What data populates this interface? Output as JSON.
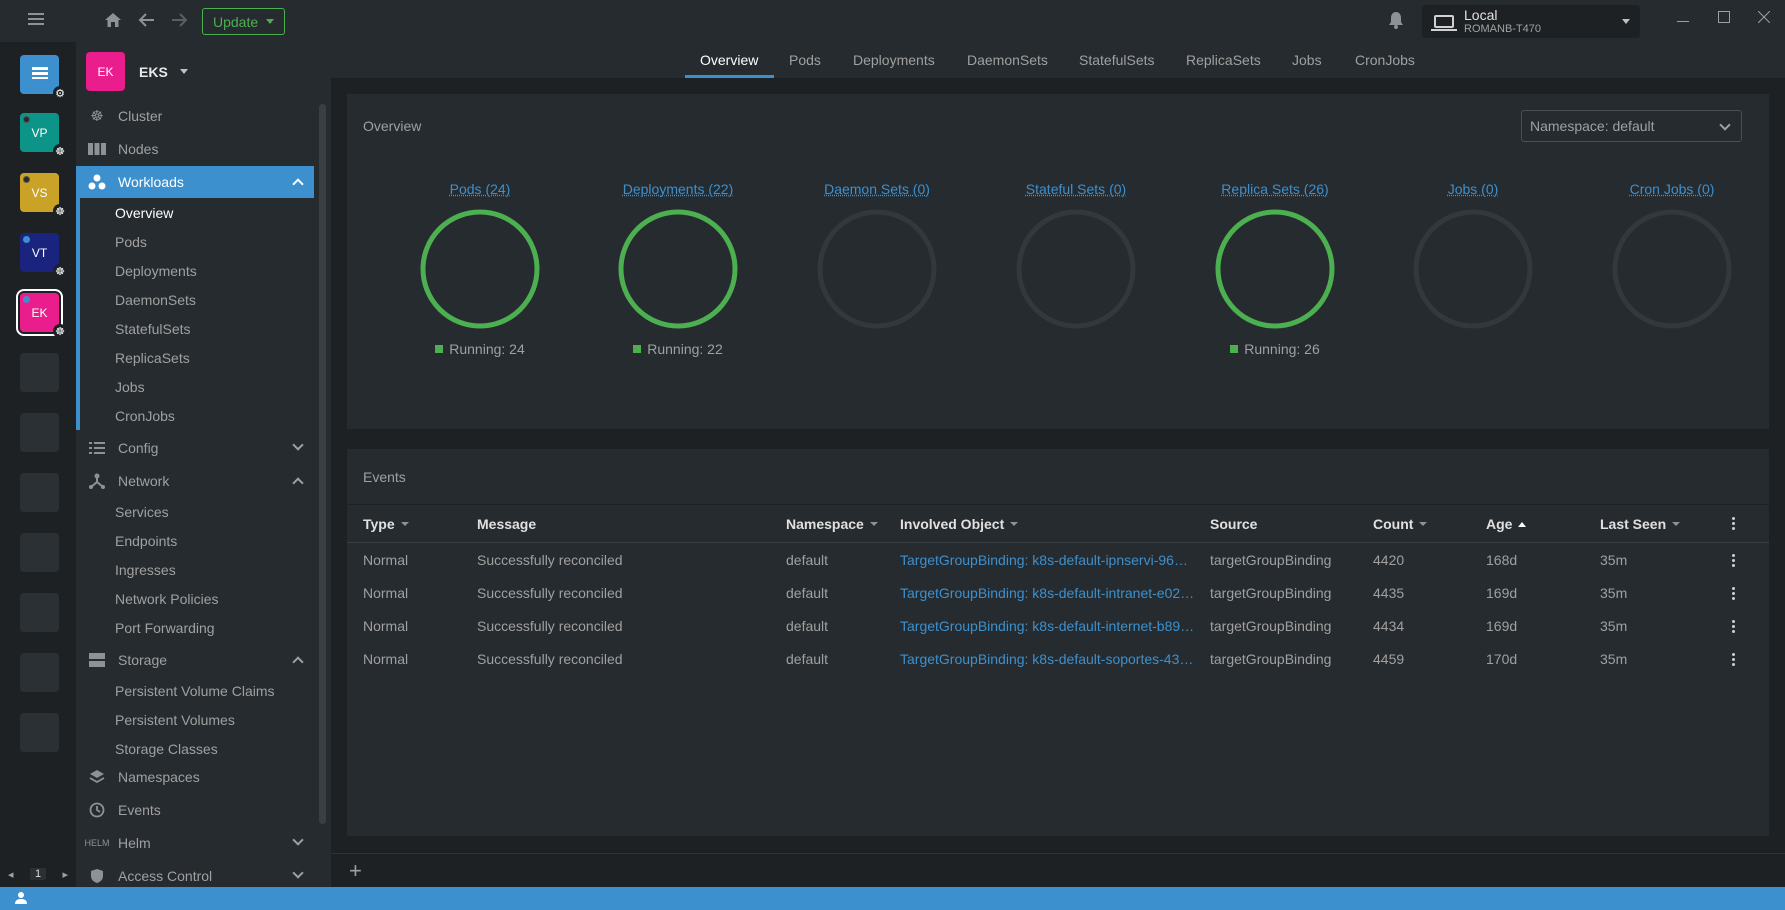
{
  "topbar": {
    "update_label": "Update",
    "context_name": "Local",
    "context_host": "ROMANB-T470"
  },
  "hotbar": {
    "items": [
      {
        "label": "",
        "color": "#3d90ce"
      },
      {
        "label": "VP",
        "color": "#0d9488"
      },
      {
        "label": "VS",
        "color": "#c9a227"
      },
      {
        "label": "VT",
        "color": "#1a237e"
      },
      {
        "label": "EK",
        "color": "#e91e8c"
      }
    ],
    "page": "1"
  },
  "cluster": {
    "avatar": "EK",
    "name": "EKS"
  },
  "sidebar": {
    "cluster": "Cluster",
    "nodes": "Nodes",
    "workloads": "Workloads",
    "workloads_items": [
      "Overview",
      "Pods",
      "Deployments",
      "DaemonSets",
      "StatefulSets",
      "ReplicaSets",
      "Jobs",
      "CronJobs"
    ],
    "config": "Config",
    "network": "Network",
    "network_items": [
      "Services",
      "Endpoints",
      "Ingresses",
      "Network Policies",
      "Port Forwarding"
    ],
    "storage": "Storage",
    "storage_items": [
      "Persistent Volume Claims",
      "Persistent Volumes",
      "Storage Classes"
    ],
    "namespaces": "Namespaces",
    "events": "Events",
    "helm": "Helm",
    "access_control": "Access Control"
  },
  "tabs": [
    "Overview",
    "Pods",
    "Deployments",
    "DaemonSets",
    "StatefulSets",
    "ReplicaSets",
    "Jobs",
    "CronJobs"
  ],
  "overview": {
    "title": "Overview",
    "namespace_select": "Namespace: default"
  },
  "colors": {
    "accent": "#3d90ce",
    "running": "#4caf50",
    "empty_ring": "#33383c"
  },
  "charts": [
    {
      "title": "Pods (24)",
      "running": 24,
      "legend": "Running: 24"
    },
    {
      "title": "Deployments (22)",
      "running": 22,
      "legend": "Running: 22"
    },
    {
      "title": "Daemon Sets (0)",
      "running": 0,
      "legend": ""
    },
    {
      "title": "Stateful Sets (0)",
      "running": 0,
      "legend": ""
    },
    {
      "title": "Replica Sets (26)",
      "running": 26,
      "legend": "Running: 26"
    },
    {
      "title": "Jobs (0)",
      "running": 0,
      "legend": ""
    },
    {
      "title": "Cron Jobs (0)",
      "running": 0,
      "legend": ""
    }
  ],
  "events": {
    "title": "Events",
    "columns": [
      "Type",
      "Message",
      "Namespace",
      "Involved Object",
      "Source",
      "Count",
      "Age",
      "Last Seen"
    ],
    "rows": [
      {
        "type": "Normal",
        "message": "Successfully reconciled",
        "namespace": "default",
        "object": "TargetGroupBinding: k8s-default-ipnservi-96b…",
        "source": "targetGroupBinding",
        "count": "4420",
        "age": "168d",
        "last_seen": "35m"
      },
      {
        "type": "Normal",
        "message": "Successfully reconciled",
        "namespace": "default",
        "object": "TargetGroupBinding: k8s-default-intranet-e02…",
        "source": "targetGroupBinding",
        "count": "4435",
        "age": "169d",
        "last_seen": "35m"
      },
      {
        "type": "Normal",
        "message": "Successfully reconciled",
        "namespace": "default",
        "object": "TargetGroupBinding: k8s-default-internet-b89…",
        "source": "targetGroupBinding",
        "count": "4434",
        "age": "169d",
        "last_seen": "35m"
      },
      {
        "type": "Normal",
        "message": "Successfully reconciled",
        "namespace": "default",
        "object": "TargetGroupBinding: k8s-default-soportes-43…",
        "source": "targetGroupBinding",
        "count": "4459",
        "age": "170d",
        "last_seen": "35m"
      }
    ]
  }
}
